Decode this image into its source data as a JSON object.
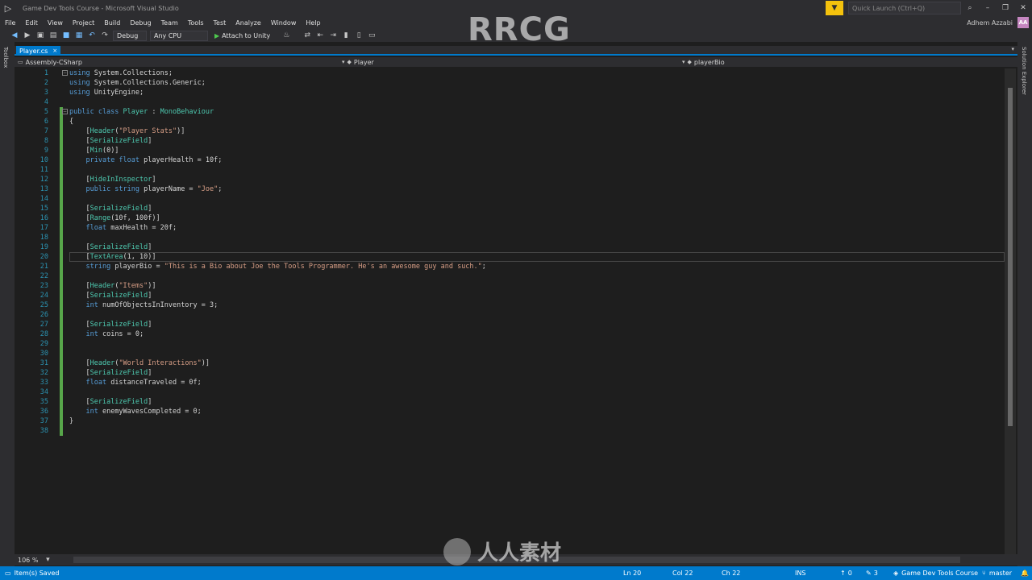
{
  "window": {
    "title": "Game Dev Tools Course - Microsoft Visual Studio",
    "quick_launch_placeholder": "Quick Launch (Ctrl+Q)",
    "user_name": "Adhem Azzabi",
    "user_initials": "AA"
  },
  "menu": {
    "items": [
      "File",
      "Edit",
      "View",
      "Project",
      "Build",
      "Debug",
      "Team",
      "Tools",
      "Test",
      "Analyze",
      "Window",
      "Help"
    ]
  },
  "toolbar": {
    "configuration": "Debug",
    "platform": "Any CPU",
    "attach_label": "Attach to Unity"
  },
  "side": {
    "left_label": "Toolbox",
    "right_label": "Solution Explorer"
  },
  "tab": {
    "label": "Player.cs",
    "close": "×"
  },
  "nav": {
    "project": "Assembly-CSharp",
    "class": "Player",
    "member": "playerBio"
  },
  "code": [
    [
      [
        "kw",
        "using"
      ],
      [
        "pl",
        " System.Collections;"
      ]
    ],
    [
      [
        "kw",
        "using"
      ],
      [
        "pl",
        " System.Collections.Generic;"
      ]
    ],
    [
      [
        "kw",
        "using"
      ],
      [
        "pl",
        " UnityEngine;"
      ]
    ],
    [],
    [
      [
        "kw",
        "public class "
      ],
      [
        "ty",
        "Player"
      ],
      [
        "pl",
        " : "
      ],
      [
        "ty",
        "MonoBehaviour"
      ]
    ],
    [
      [
        "pl",
        "{"
      ]
    ],
    [
      [
        "pl",
        "    ["
      ],
      [
        "attr",
        "Header"
      ],
      [
        "pl",
        "("
      ],
      [
        "str",
        "\"Player Stats\""
      ],
      [
        "pl",
        ")]"
      ]
    ],
    [
      [
        "pl",
        "    ["
      ],
      [
        "attr",
        "SerializeField"
      ],
      [
        "pl",
        "]"
      ]
    ],
    [
      [
        "pl",
        "    ["
      ],
      [
        "attr",
        "Min"
      ],
      [
        "pl",
        "(0)]"
      ]
    ],
    [
      [
        "pl",
        "    "
      ],
      [
        "kw",
        "private float"
      ],
      [
        "pl",
        " playerHealth = 10f;"
      ]
    ],
    [],
    [
      [
        "pl",
        "    ["
      ],
      [
        "attr",
        "HideInInspector"
      ],
      [
        "pl",
        "]"
      ]
    ],
    [
      [
        "pl",
        "    "
      ],
      [
        "kw",
        "public string"
      ],
      [
        "pl",
        " playerName = "
      ],
      [
        "str",
        "\"Joe\""
      ],
      [
        "pl",
        ";"
      ]
    ],
    [],
    [
      [
        "pl",
        "    ["
      ],
      [
        "attr",
        "SerializeField"
      ],
      [
        "pl",
        "]"
      ]
    ],
    [
      [
        "pl",
        "    ["
      ],
      [
        "attr",
        "Range"
      ],
      [
        "pl",
        "(10f, 100f)]"
      ]
    ],
    [
      [
        "pl",
        "    "
      ],
      [
        "kw",
        "float"
      ],
      [
        "pl",
        " maxHealth = 20f;"
      ]
    ],
    [],
    [
      [
        "pl",
        "    ["
      ],
      [
        "attr",
        "SerializeField"
      ],
      [
        "pl",
        "]"
      ]
    ],
    [
      [
        "pl",
        "    ["
      ],
      [
        "attr",
        "TextArea"
      ],
      [
        "pl",
        "(1, 10)]"
      ]
    ],
    [
      [
        "pl",
        "    "
      ],
      [
        "kw",
        "string"
      ],
      [
        "pl",
        " playerBio = "
      ],
      [
        "str",
        "\"This is a Bio about Joe the Tools Programmer. He's an awesome guy and such.\""
      ],
      [
        "pl",
        ";"
      ]
    ],
    [],
    [
      [
        "pl",
        "    ["
      ],
      [
        "attr",
        "Header"
      ],
      [
        "pl",
        "("
      ],
      [
        "str",
        "\"Items\""
      ],
      [
        "pl",
        ")]"
      ]
    ],
    [
      [
        "pl",
        "    ["
      ],
      [
        "attr",
        "SerializeField"
      ],
      [
        "pl",
        "]"
      ]
    ],
    [
      [
        "pl",
        "    "
      ],
      [
        "kw",
        "int"
      ],
      [
        "pl",
        " numOfObjectsInInventory = 3;"
      ]
    ],
    [],
    [
      [
        "pl",
        "    ["
      ],
      [
        "attr",
        "SerializeField"
      ],
      [
        "pl",
        "]"
      ]
    ],
    [
      [
        "pl",
        "    "
      ],
      [
        "kw",
        "int"
      ],
      [
        "pl",
        " coins = 0;"
      ]
    ],
    [],
    [],
    [
      [
        "pl",
        "    ["
      ],
      [
        "attr",
        "Header"
      ],
      [
        "pl",
        "("
      ],
      [
        "str",
        "\"World Interactions\""
      ],
      [
        "pl",
        ")]"
      ]
    ],
    [
      [
        "pl",
        "    ["
      ],
      [
        "attr",
        "SerializeField"
      ],
      [
        "pl",
        "]"
      ]
    ],
    [
      [
        "pl",
        "    "
      ],
      [
        "kw",
        "float"
      ],
      [
        "pl",
        " distanceTraveled = 0f;"
      ]
    ],
    [],
    [
      [
        "pl",
        "    ["
      ],
      [
        "attr",
        "SerializeField"
      ],
      [
        "pl",
        "]"
      ]
    ],
    [
      [
        "pl",
        "    "
      ],
      [
        "kw",
        "int"
      ],
      [
        "pl",
        " enemyWavesCompleted = 0;"
      ]
    ],
    [
      [
        "pl",
        "}"
      ]
    ],
    []
  ],
  "zoom": "106 %",
  "status": {
    "message": "Item(s) Saved",
    "line": "Ln 20",
    "col": "Col 22",
    "ch": "Ch 22",
    "mode": "INS",
    "arrow_up_count": "0",
    "pencil_count": "3",
    "repo": "Game Dev Tools Course",
    "branch": "master"
  },
  "watermark": {
    "top": "RRCG",
    "bottom": "人人素材"
  }
}
